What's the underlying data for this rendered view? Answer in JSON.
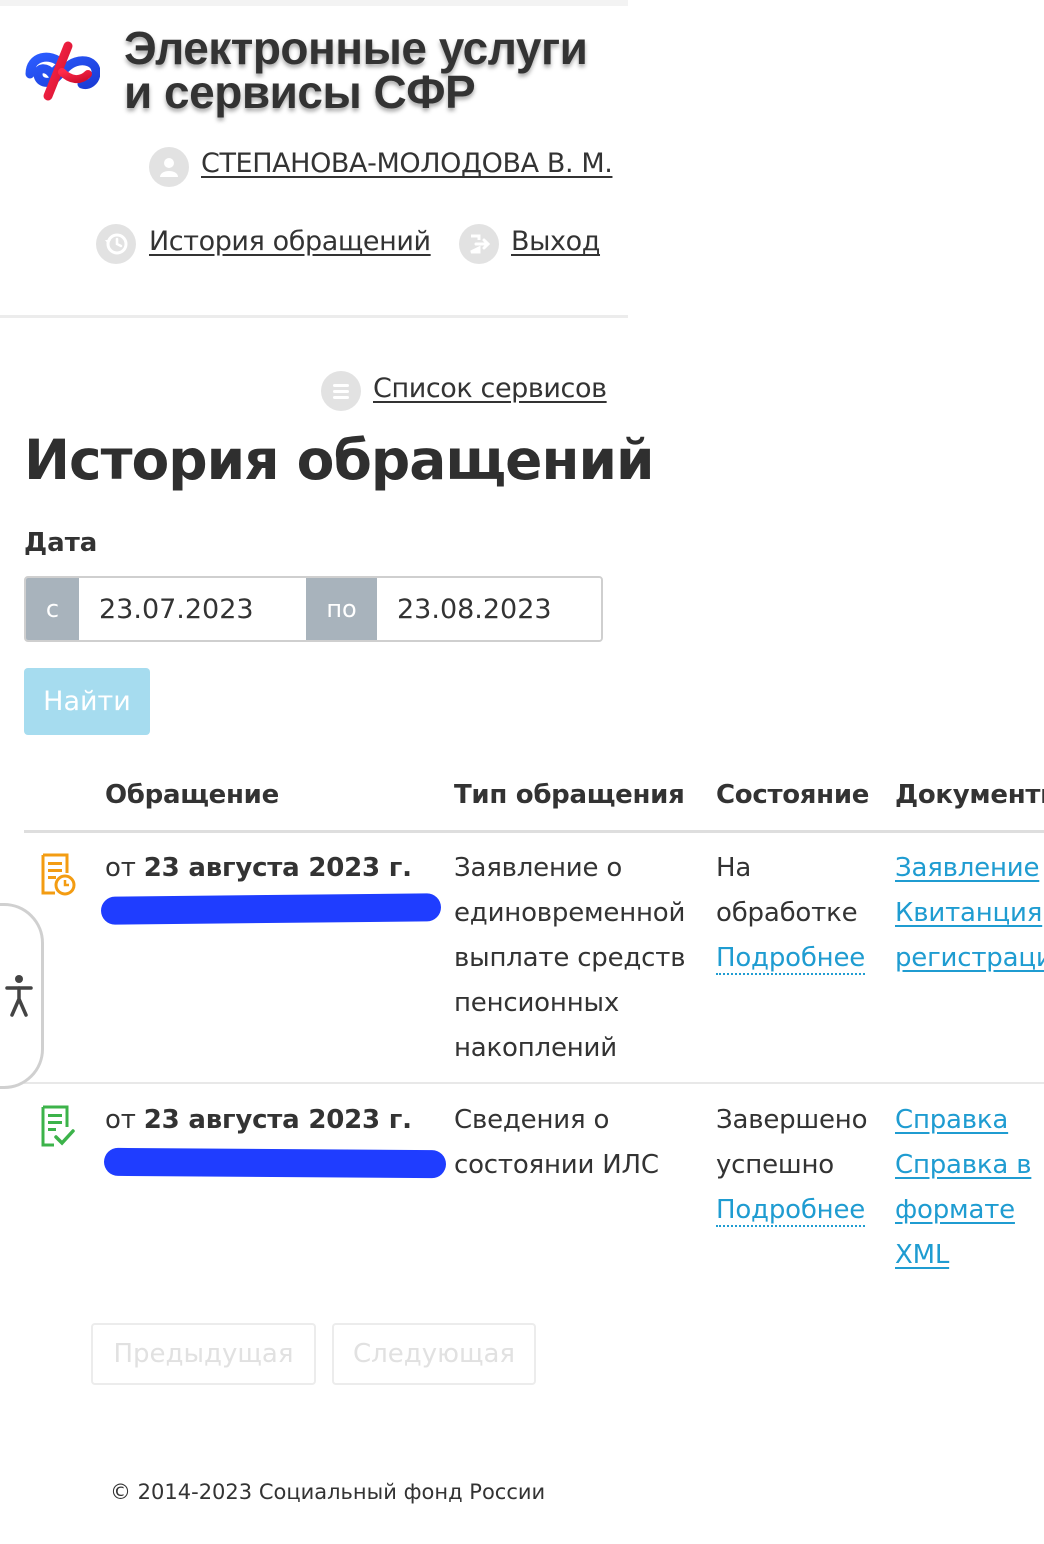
{
  "header": {
    "title_line1": "Электронные услуги",
    "title_line2": "и сервисы СФР",
    "user_name": "СТЕПАНОВА-МОЛОДОВА В. М.",
    "history_link": "История обращений",
    "logout_link": "Выход"
  },
  "services_link": "Список сервисов",
  "page_title": "История обращений",
  "filter": {
    "date_label": "Дата",
    "from_label": "с",
    "from_value": "23.07.2023",
    "to_label": "по",
    "to_value": "23.08.2023",
    "find_button": "Найти"
  },
  "table": {
    "headers": [
      "Обращение",
      "Тип обращения",
      "Состояние",
      "Документы"
    ],
    "rows": [
      {
        "date_prefix": "от ",
        "date": "23 августа 2023 г.",
        "type": "Заявление о единовременной выплате средств пенсионных накоплений",
        "status": "На обработке",
        "status_link": "Подробнее",
        "documents": [
          "Заявление",
          "Квитанция",
          "регистрации"
        ],
        "icon": "document-clock-icon",
        "icon_color": "#f39c12"
      },
      {
        "date_prefix": "от ",
        "date": "23 августа 2023 г.",
        "type": "Сведения о состоянии ИЛС",
        "status": "Завершено успешно",
        "status_link": "Подробнее",
        "documents": [
          "Справка",
          "Справка в формате XML"
        ],
        "icon": "document-check-icon",
        "icon_color": "#3cb34a"
      }
    ]
  },
  "pagination": {
    "prev": "Предыдущая",
    "next": "Следующая"
  },
  "footer": "© 2014-2023 Социальный фонд России",
  "colors": {
    "link": "#1f9cd1",
    "button_disabled": "#a6dcef",
    "addon": "#a8b3bc"
  }
}
